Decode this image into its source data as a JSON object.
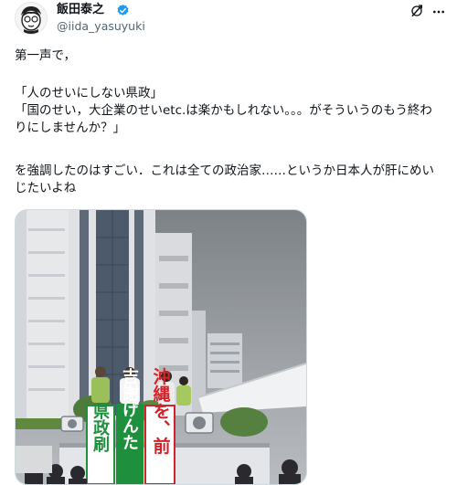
{
  "author": {
    "display_name": "飯田泰之",
    "handle": "@iida_yasuyuki",
    "verified": true,
    "avatar_icon": "caricature-avatar-icon"
  },
  "header_actions": {
    "grok_icon": "grok-icon",
    "more_icon": "more-dots-icon"
  },
  "tweet": {
    "line1": "第一声で，",
    "line2": "「人のせいにしない県政」",
    "line3": "「国のせい，大企業のせいetc.は楽かもしれない。。。がそういうのもう終わりにしませんか？」",
    "line4": "を強調したのはすごい．これは全ての政治家……というか日本人が肝にめいじたいよね"
  },
  "media": {
    "type": "photo",
    "banner_left": "県政刷",
    "banner_mid": "吉謝げんた",
    "banner_right": "沖縄を、前"
  },
  "colors": {
    "text": "#0f1419",
    "secondary": "#536471",
    "verified_blue": "#1d9bf0",
    "banner_green": "#1e8f3c",
    "banner_red": "#d2232a"
  }
}
